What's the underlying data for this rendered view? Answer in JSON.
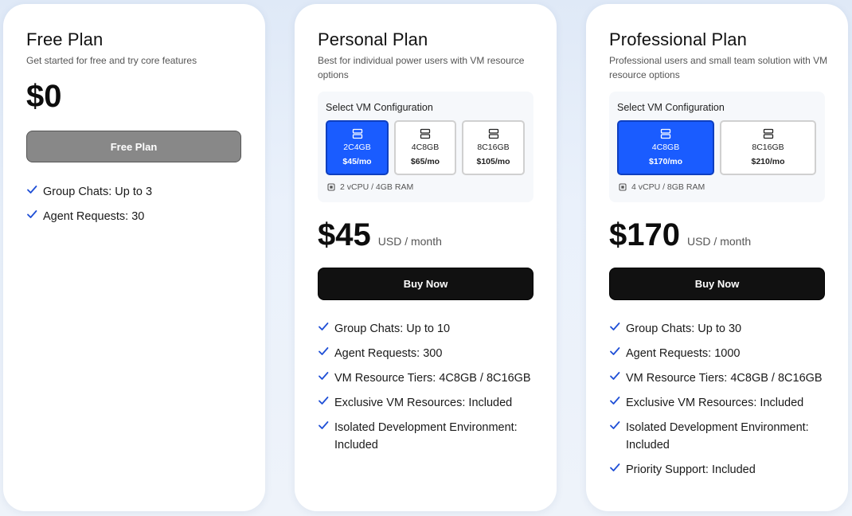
{
  "colors": {
    "accent": "#1a5cff",
    "check": "#1f4fd6",
    "buy_button": "#111111",
    "free_button": "#888888"
  },
  "plans": {
    "free": {
      "title": "Free Plan",
      "description": "Get started for free and try core features",
      "price": "$0",
      "button_label": "Free Plan",
      "features": [
        "Group Chats: Up to 3",
        "Agent Requests: 30"
      ]
    },
    "personal": {
      "title": "Personal Plan",
      "description": "Best for individual power users with VM resource options",
      "vm_label": "Select VM Configuration",
      "vm_options": [
        {
          "config": "2C4GB",
          "price": "$45/mo",
          "selected": true,
          "icon": "server-icon"
        },
        {
          "config": "4C8GB",
          "price": "$65/mo",
          "selected": false,
          "icon": "server-icon"
        },
        {
          "config": "8C16GB",
          "price": "$105/mo",
          "selected": false,
          "icon": "server-icon"
        }
      ],
      "vm_spec": "2 vCPU / 4GB RAM",
      "price": "$45",
      "price_unit": "USD / month",
      "button_label": "Buy Now",
      "features": [
        "Group Chats: Up to 10",
        "Agent Requests: 300",
        "VM Resource Tiers: 4C8GB / 8C16GB",
        "Exclusive VM Resources: Included",
        "Isolated Development Environment: Included"
      ]
    },
    "professional": {
      "title": "Professional Plan",
      "description": "Professional users and small team solution with VM resource options",
      "vm_label": "Select VM Configuration",
      "vm_options": [
        {
          "config": "4C8GB",
          "price": "$170/mo",
          "selected": true,
          "icon": "server-icon"
        },
        {
          "config": "8C16GB",
          "price": "$210/mo",
          "selected": false,
          "icon": "server-icon"
        }
      ],
      "vm_spec": "4 vCPU / 8GB RAM",
      "price": "$170",
      "price_unit": "USD / month",
      "button_label": "Buy Now",
      "features": [
        "Group Chats: Up to 30",
        "Agent Requests: 1000",
        "VM Resource Tiers: 4C8GB / 8C16GB",
        "Exclusive VM Resources: Included",
        "Isolated Development Environment: Included",
        "Priority Support: Included"
      ]
    }
  }
}
